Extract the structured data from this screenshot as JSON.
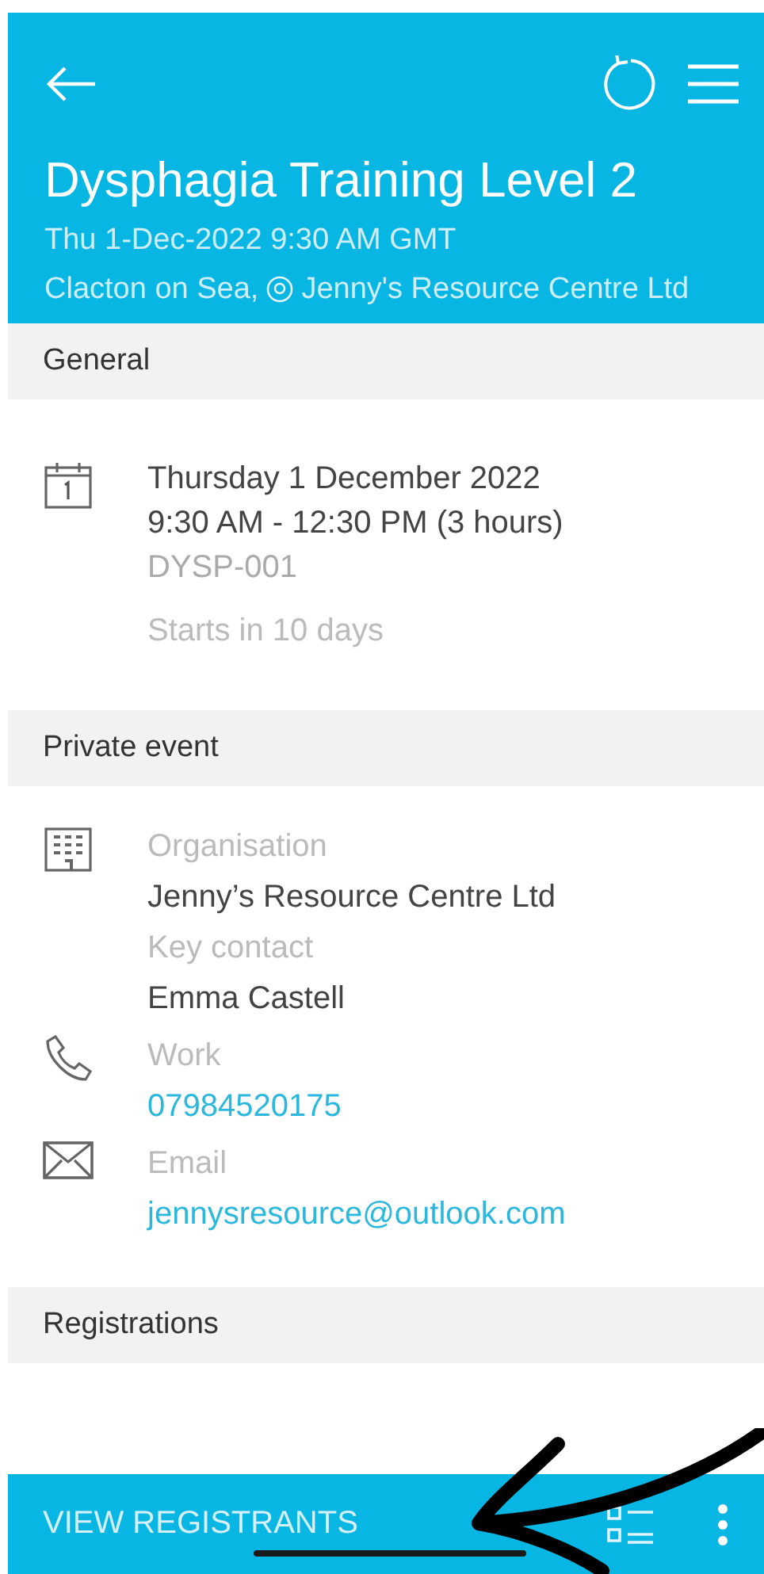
{
  "header": {
    "title": "Dysphagia Training Level 2",
    "datetime": "Thu 1-Dec-2022 9:30 AM GMT",
    "location_prefix": "Clacton on Sea,",
    "location_org": "Jenny's Resource Centre Ltd"
  },
  "sections": [
    {
      "heading": "General",
      "kind": "when",
      "lines": [
        {
          "text": "Thursday 1 December 2022",
          "kind": "primary"
        },
        {
          "text": "9:30 AM - 12:30 PM (3 hours)",
          "kind": "primary"
        },
        {
          "text": "DYSP-001",
          "kind": "muted"
        },
        {
          "text": "Starts in 10 days",
          "kind": "note"
        }
      ]
    },
    {
      "heading": "Private event",
      "kind": "contacts",
      "groups": [
        {
          "kind": "organisation",
          "fields": [
            {
              "label": "Organisation",
              "value": "Jenny’s Resource Centre Ltd",
              "link": false
            },
            {
              "label": "Key contact",
              "value": "Emma Castell",
              "link": false
            }
          ]
        },
        {
          "kind": "phone",
          "fields": [
            {
              "label": "Work",
              "value": "07984520175",
              "link": true
            }
          ]
        },
        {
          "kind": "email",
          "fields": [
            {
              "label": "Email",
              "value": "jennysresource@outlook.com",
              "link": true
            }
          ]
        }
      ]
    },
    {
      "heading": "Registrations",
      "kind": "empty"
    }
  ],
  "bottom_bar": {
    "action": "VIEW REGISTRANTS"
  }
}
